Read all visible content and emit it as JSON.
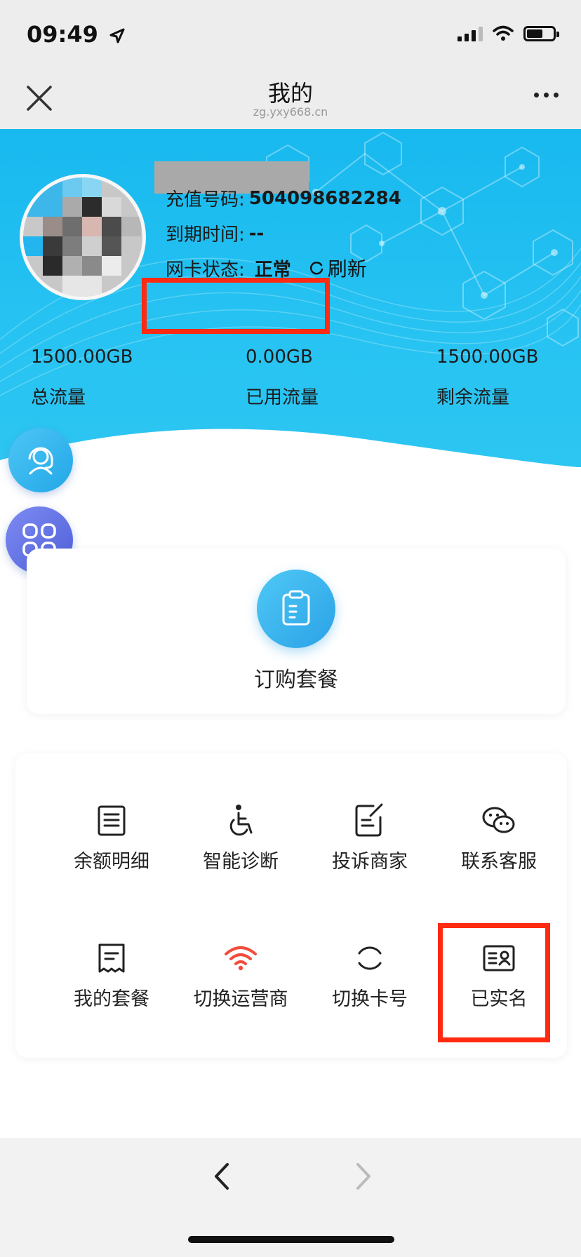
{
  "status_bar": {
    "time": "09:49"
  },
  "nav": {
    "title": "我的",
    "url": "zg.yxy668.cn"
  },
  "profile": {
    "recharge_label": "充值号码:",
    "recharge_number": "504098682284",
    "expiry_label": "到期时间:",
    "expiry_value": "--",
    "card_status_label": "网卡状态:",
    "card_status_value": "正常",
    "refresh_label": "刷新"
  },
  "stats": [
    {
      "value": "1500.00GB",
      "label": "总流量"
    },
    {
      "value": "0.00GB",
      "label": "已用流量"
    },
    {
      "value": "1500.00GB",
      "label": "剩余流量"
    }
  ],
  "order": {
    "label": "订购套餐"
  },
  "menu": [
    {
      "label": "余额明细",
      "icon": "balance-detail-icon"
    },
    {
      "label": "智能诊断",
      "icon": "accessibility-icon"
    },
    {
      "label": "投诉商家",
      "icon": "complaint-icon"
    },
    {
      "label": "联系客服",
      "icon": "wechat-icon"
    },
    {
      "label": "我的套餐",
      "icon": "receipt-icon"
    },
    {
      "label": "切换运营商",
      "icon": "wifi-icon",
      "icon_color": "#f24c3d"
    },
    {
      "label": "切换卡号",
      "icon": "switch-card-icon"
    },
    {
      "label": "已实名",
      "icon": "id-card-icon"
    }
  ],
  "colors": {
    "hero": "#1fbef0",
    "highlight": "#ff2a12",
    "accent": "#2ba2e6"
  }
}
